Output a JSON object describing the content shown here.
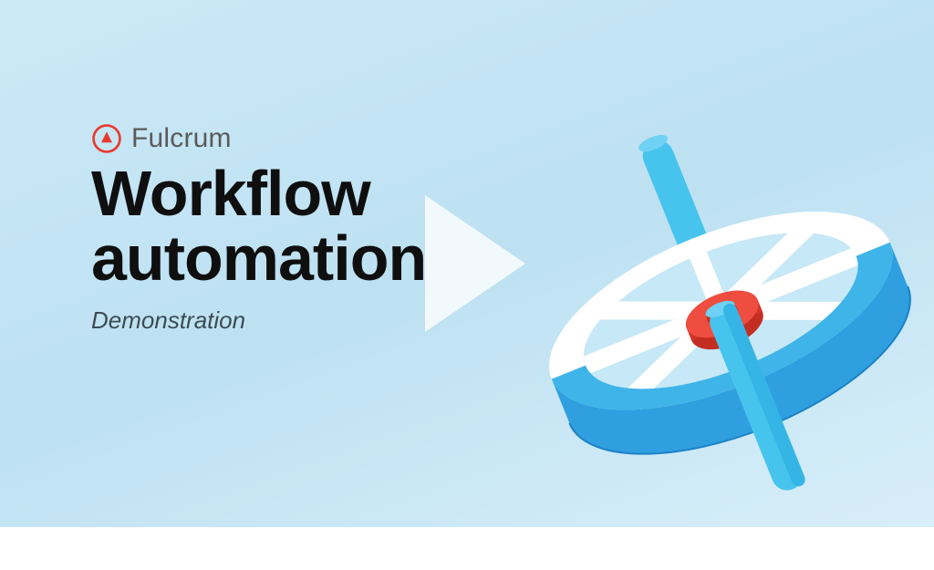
{
  "brand": {
    "name": "Fulcrum"
  },
  "headline_line1": "Workflow",
  "headline_line2": "automation",
  "subhead": "Demonstration",
  "colors": {
    "accent_red": "#e83b2e",
    "wheel_blue_light": "#46c4ee",
    "wheel_blue_dark": "#1e8ed6",
    "bg_start": "#cce9f7",
    "bg_end": "#d8eef9",
    "text_dark": "#0f0f0f",
    "text_gray": "#5a5a5a"
  }
}
